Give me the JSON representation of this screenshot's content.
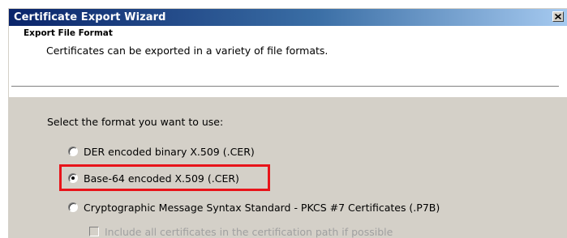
{
  "window": {
    "title": "Certificate Export Wizard",
    "close_icon": "close-icon"
  },
  "header": {
    "title": "Export File Format",
    "subtitle": "Certificates can be exported in a variety of file formats."
  },
  "main": {
    "prompt": "Select the format you want to use:",
    "options": [
      {
        "label": "DER encoded binary X.509 (.CER)",
        "selected": false
      },
      {
        "label": "Base-64 encoded X.509 (.CER)",
        "selected": true
      },
      {
        "label": "Cryptographic Message Syntax Standard - PKCS #7 Certificates (.P7B)",
        "selected": false
      }
    ],
    "sub_option": {
      "label": "Include all certificates in the certification path if possible",
      "checked": false,
      "enabled": false
    }
  },
  "annotation": {
    "highlight_color": "#e8141a"
  },
  "colors": {
    "titlebar_start": "#0a246a",
    "titlebar_end": "#a6caf0",
    "dialog_face": "#d4d0c8",
    "header_background": "#ffffff"
  }
}
